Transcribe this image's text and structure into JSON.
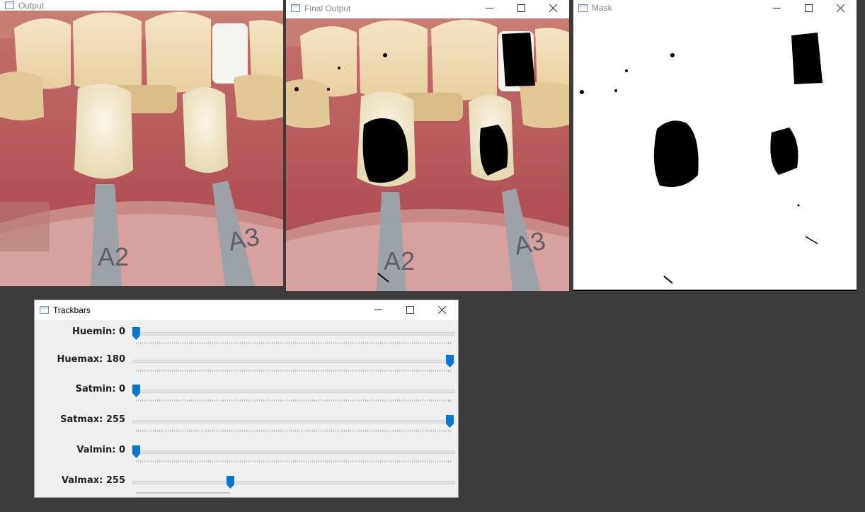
{
  "windows": {
    "output": {
      "title": "Output"
    },
    "final_output": {
      "title": "Final Output"
    },
    "mask": {
      "title": "Mask"
    },
    "trackbars": {
      "title": "Trackbars"
    }
  },
  "images": {
    "output": {
      "labels": [
        "A2",
        "A3"
      ]
    },
    "final_output": {
      "labels": [
        "A2",
        "A3"
      ]
    }
  },
  "trackbars": [
    {
      "name": "Huemin",
      "value": 0,
      "max": 180
    },
    {
      "name": "Huemax",
      "value": 180,
      "max": 180
    },
    {
      "name": "Satmin",
      "value": 0,
      "max": 255
    },
    {
      "name": "Satmax",
      "value": 255,
      "max": 255
    },
    {
      "name": "Valmin",
      "value": 0,
      "max": 255
    },
    {
      "name": "Valmax",
      "value": 255,
      "max": 255,
      "thumb_fraction": 0.3
    }
  ],
  "colors": {
    "desktop": "#3c3c3c",
    "thumb": "#0078d7",
    "gums": "#b85a5c",
    "tooth": "#f1ddb5"
  },
  "icons": {
    "window_app": "opencv-window-icon",
    "minimize": "minimize-icon",
    "maximize": "maximize-icon",
    "close": "close-icon"
  }
}
